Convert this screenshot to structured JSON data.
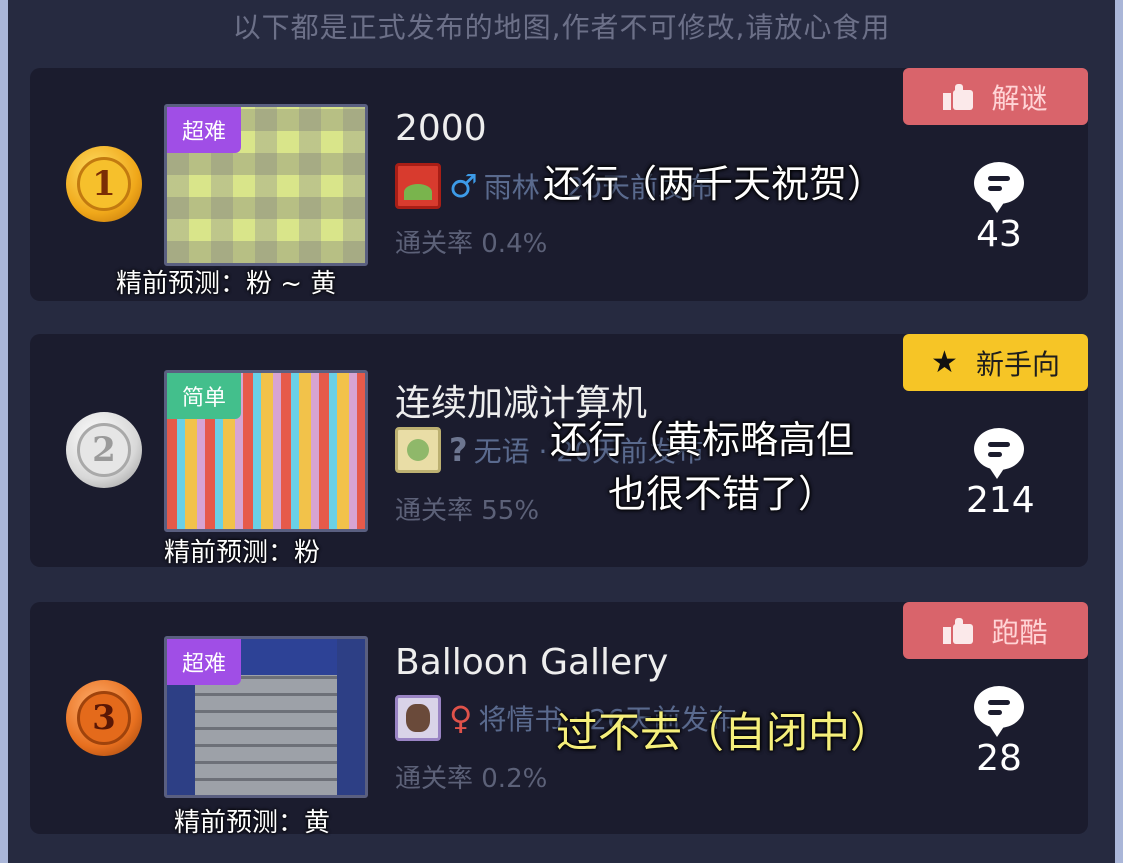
{
  "header": "以下都是正式发布的地图,作者不可修改,请放心食用",
  "levels": [
    {
      "rank": "1",
      "difficulty": "超难",
      "title": "2000",
      "author_line": "雨林 · 20天前发布",
      "clear_rate": "通关率 0.4%",
      "comments": "43",
      "tag": "解谜",
      "caption": "精前预测：粉 ~ 黄",
      "note": "还行（两千天祝贺）",
      "note_line2": "",
      "gender": "♂"
    },
    {
      "rank": "2",
      "difficulty": "简单",
      "title": "连续加减计算机",
      "author_line": "无语 · 20天前发布",
      "clear_rate": "通关率 55%",
      "comments": "214",
      "tag": "新手向",
      "caption": "精前预测：粉",
      "note": "还行（黄标略高但",
      "note_line2": "也很不错了）",
      "gender": "?"
    },
    {
      "rank": "3",
      "difficulty": "超难",
      "title": "Balloon Gallery",
      "author_line": "将情书 · 26天前发布",
      "clear_rate": "通关率 0.2%",
      "comments": "28",
      "tag": "跑酷",
      "caption": "精前预测：黄",
      "note": "过不去（自闭中）",
      "note_line2": "",
      "gender": "♀"
    }
  ],
  "colors": {
    "background": "#262a40",
    "card": "#1b1c2e",
    "tag_red": "#d9646b",
    "tag_yellow": "#f6c526",
    "difficulty_hard": "#a04ee6",
    "difficulty_easy": "#43bf8c",
    "note_yellow": "#f5ef7b"
  },
  "icons": {
    "medal_1": "gold-medal-icon",
    "medal_2": "silver-medal-icon",
    "medal_3": "bronze-medal-icon",
    "comment": "speech-bubble-icon",
    "like": "thumbs-up-icon",
    "star": "star-icon"
  }
}
